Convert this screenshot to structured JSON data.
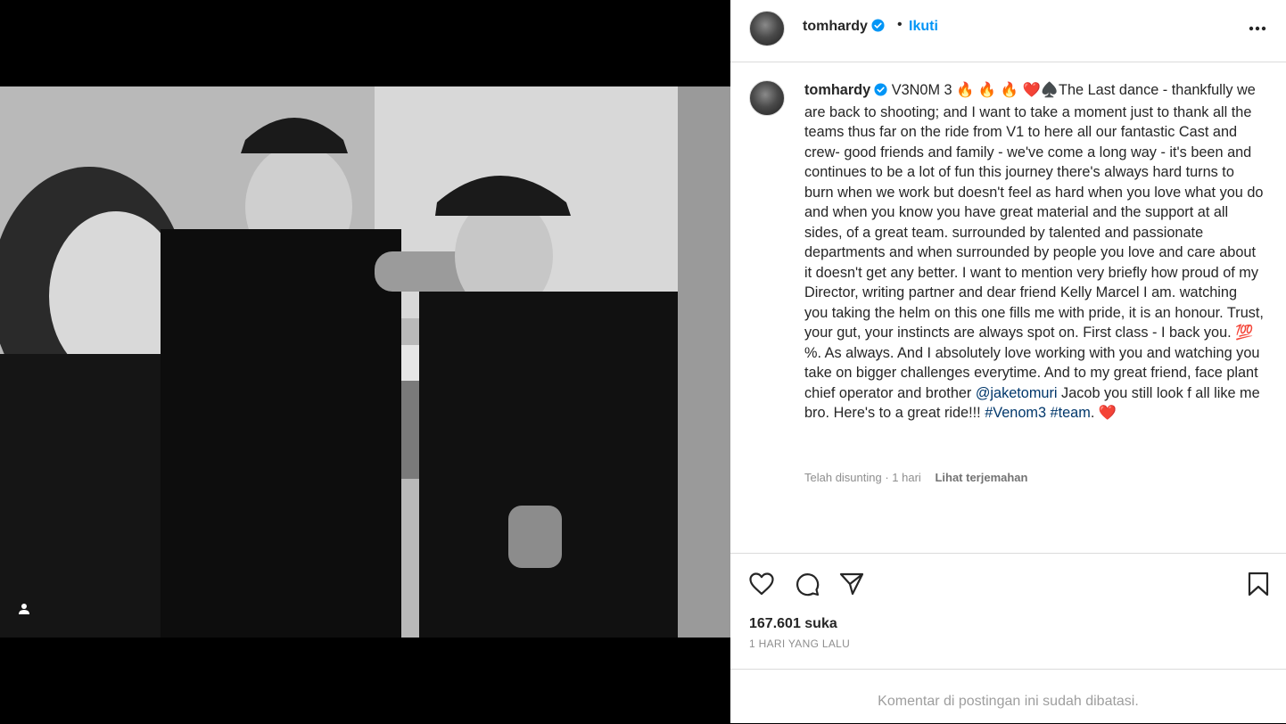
{
  "post": {
    "username": "tomhardy",
    "follow_label": "Ikuti",
    "dot": "•",
    "caption_text": "V3N0M 3 🔥 🔥 🔥 ❤️♠️The Last dance - thankfully we are back to shooting; and I want to take a moment just to thank all the teams thus far on the ride from V1 to here all our fantastic Cast and crew- good friends and family - we've come a long way - it's been and continues to be a lot of fun this journey there's always hard turns to burn when we work but doesn't feel as hard when you love what you do and when you know you have great material and the support at all sides, of a great team. surrounded by talented and passionate departments and when surrounded by people you love and care about it doesn't get any better. I want to mention very briefly how proud of my Director, writing partner and dear friend Kelly Marcel I am. watching you taking the helm on this one fills me with pride, it is an honour. Trust, your gut, your instincts are always spot on. First class - I back you. 💯 %. As always. And I absolutely love working with you and watching you take on bigger challenges everytime. And to my great friend, face plant chief operator and brother",
    "mention": "@jaketomuri",
    "caption_after_mention": " Jacob you still look f all like me bro. Here's to a great ride!!! ",
    "hashtag_1": "#Venom3",
    "hashtag_2": "#team",
    "caption_end": ". ❤️",
    "edited_label": "Telah disunting",
    "edited_sep": " · ",
    "edited_time": "1 hari",
    "translate_label": "Lihat terjemahan",
    "likes": "167.601 suka",
    "date": "1 HARI YANG LALU",
    "comments_disabled": "Komentar di postingan ini sudah dibatasi."
  },
  "icons": {
    "verified": "verified-badge-icon",
    "more": "more-options-icon",
    "like": "heart-icon",
    "comment": "comment-icon",
    "share": "paper-plane-icon",
    "save": "bookmark-icon",
    "user_tag": "user-tag-icon"
  },
  "colors": {
    "accent": "#0095f6",
    "link": "#00376b",
    "verified": "#0095f6",
    "muted": "#8e8e8e"
  }
}
